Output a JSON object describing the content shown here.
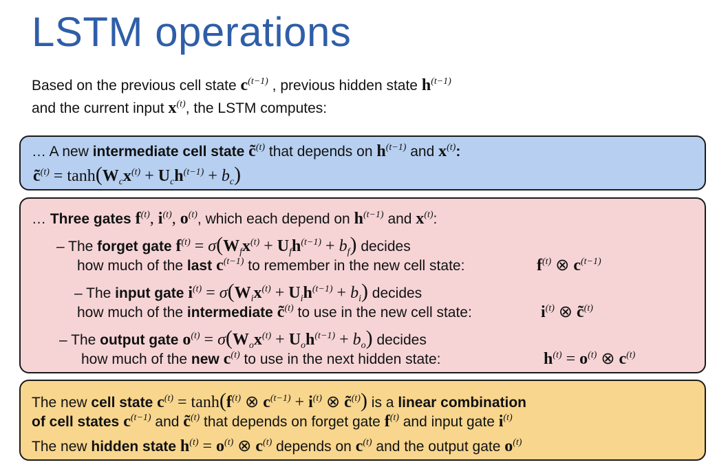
{
  "title": "LSTM operations",
  "intro": {
    "line1_a": "Based on the previous cell state ",
    "line1_b": " , previous hidden state ",
    "line2_a": "and the current input ",
    "line2_b": ", the LSTM computes:"
  },
  "box1": {
    "line1_a": "… A new ",
    "line1_bold": "intermediate cell state",
    "line1_b": " that depends on ",
    "line1_c": " and ",
    "line1_d": ":",
    "eq_tanh": "tanh"
  },
  "box2": {
    "line1_a": "… ",
    "line1_bold": "Three gates",
    "line1_b": ", which each depend on ",
    "line1_c": " and ",
    "line1_d": ":",
    "forget_a": "– The ",
    "forget_bold": "forget gate",
    "decides": " decides",
    "forget2_a": "how much of the ",
    "forget2_bold": "last",
    "forget2_b": " to remember in the new cell state:",
    "input_a": "– The ",
    "input_bold": "input gate",
    "input2_a": "how much of the ",
    "input2_bold": "intermediate",
    "input2_b": " to use in the new cell state:",
    "output_a": "– The ",
    "output_bold": "output gate",
    "output2_a": "how much of the ",
    "output2_bold": "new",
    "output2_b": " to use in the next hidden state:"
  },
  "box3": {
    "line1_a": "The new ",
    "line1_bold": "cell state",
    "line1_tanh": " tanh",
    "line1_b": " is a ",
    "line1_bold2": "linear combination",
    "line2_bold": "of cell states",
    "line2_a": " and ",
    "line2_b": " that depends on forget gate ",
    "line2_c": " and input gate ",
    "line3_a": "The new ",
    "line3_bold": "hidden state",
    "line3_b": " depends on ",
    "line3_c": " and the output gate "
  }
}
